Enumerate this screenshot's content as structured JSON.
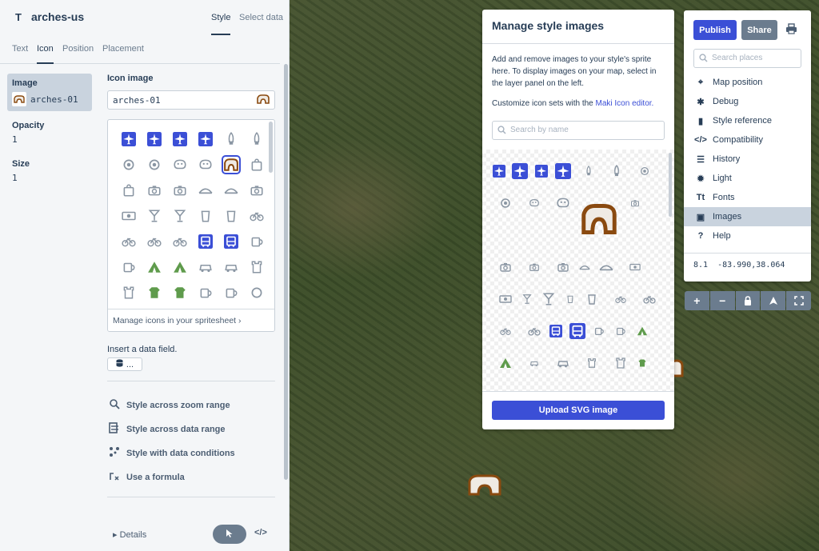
{
  "layer": {
    "type_glyph": "T",
    "name": "arches-us"
  },
  "top_tabs": {
    "style": "Style",
    "select_data": "Select data"
  },
  "sub_tabs": [
    "Text",
    "Icon",
    "Position",
    "Placement"
  ],
  "properties": [
    {
      "label": "Image",
      "value": "arches-01"
    },
    {
      "label": "Opacity",
      "value": "1"
    },
    {
      "label": "Size",
      "value": "1"
    }
  ],
  "editor": {
    "label": "Icon image",
    "input_value": "arches-01",
    "manage_link": "Manage icons in your spritesheet",
    "insert_label": "Insert a data field.",
    "insert_button": "...",
    "actions": [
      "Style across zoom range",
      "Style across data range",
      "Style with data conditions",
      "Use a formula"
    ],
    "details": "Details",
    "code_label": "</>"
  },
  "manage": {
    "title": "Manage style images",
    "description": "Add and remove images to your style's sprite here. To display images on your map, select in the layer panel on the left.",
    "maki_prefix": "Customize icon sets with the ",
    "maki_link": "Maki Icon editor.",
    "search_placeholder": "Search by name",
    "upload_label": "Upload SVG image"
  },
  "toolbar": {
    "publish": "Publish",
    "share": "Share",
    "search_placeholder": "Search places",
    "menu": [
      {
        "label": "Map position",
        "icon": "crosshair-icon",
        "glyph": "⌖"
      },
      {
        "label": "Debug",
        "icon": "bug-icon",
        "glyph": "✱"
      },
      {
        "label": "Style reference",
        "icon": "book-icon",
        "glyph": "▮"
      },
      {
        "label": "Compatibility",
        "icon": "code-icon",
        "glyph": "</>"
      },
      {
        "label": "History",
        "icon": "history-icon",
        "glyph": "☰"
      },
      {
        "label": "Light",
        "icon": "sun-icon",
        "glyph": "✹"
      },
      {
        "label": "Fonts",
        "icon": "fonts-icon",
        "glyph": "Tt"
      },
      {
        "label": "Images",
        "icon": "image-icon",
        "glyph": "▣"
      },
      {
        "label": "Help",
        "icon": "help-icon",
        "glyph": "?"
      }
    ],
    "active_menu": "Images",
    "zoom": "8.1",
    "coordinates": "-83.990,38.064"
  },
  "map_controls": [
    "+",
    "−",
    "🔒",
    "▲",
    "⤢"
  ],
  "colors": {
    "accent": "#3b4fd6",
    "sidebar_bg": "#f4f6f8",
    "active_bg": "#c9d3de",
    "arch_brown": "#8a4a10",
    "arch_fill": "#f0ebe4"
  }
}
